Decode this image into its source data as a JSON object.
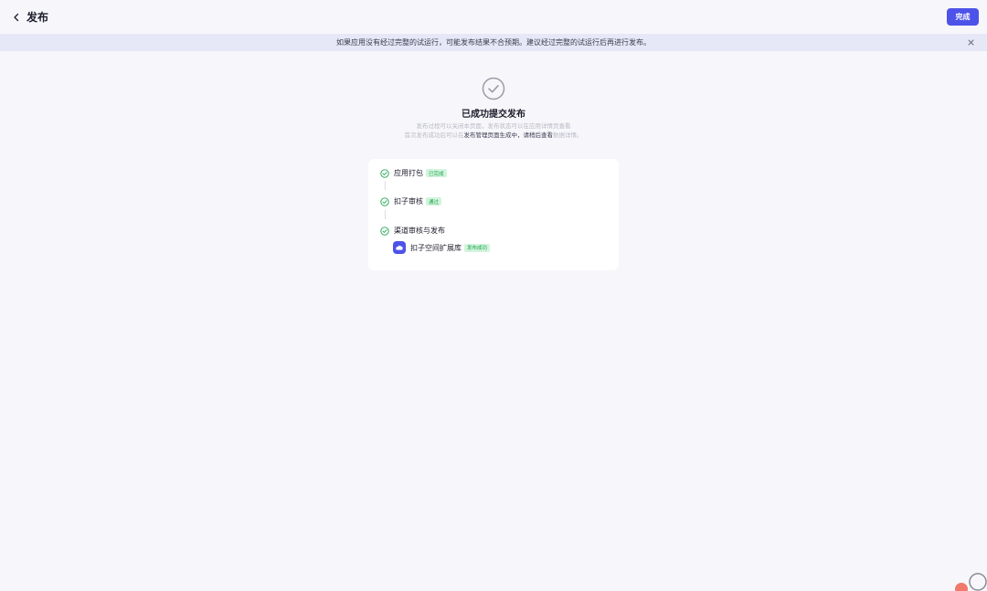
{
  "header": {
    "title": "发布",
    "done_label": "完成"
  },
  "notice": {
    "text": "如果应用没有经过完整的试运行，可能发布结果不合预期。建议经过完整的试运行后再进行发布。"
  },
  "success": {
    "title": "已成功提交发布",
    "desc_line1": "发布过程可以关闭本页面，发布状态可以在应用详情页查看",
    "desc_line2_pre": "首次发布成功后可以在",
    "desc_line2_hl": "发布管理页面生成中，请稍后查看",
    "desc_line2_post": "数据详情。"
  },
  "steps": [
    {
      "label": "应用打包",
      "badge": "已完成"
    },
    {
      "label": "扣子审核",
      "badge": "通过"
    },
    {
      "label": "渠道审核与发布",
      "badge": ""
    }
  ],
  "channel": {
    "name": "扣子空间扩展库",
    "status": "发布成功"
  },
  "colors": {
    "primary": "#4d53e8",
    "success": "#1fa550",
    "success_bg": "#d2f4dc",
    "notice_bg": "#e6e8f7"
  },
  "icons": {
    "back": "chevron-left-icon",
    "close": "close-icon",
    "success": "check-circle-icon",
    "step": "check-circle-icon"
  }
}
